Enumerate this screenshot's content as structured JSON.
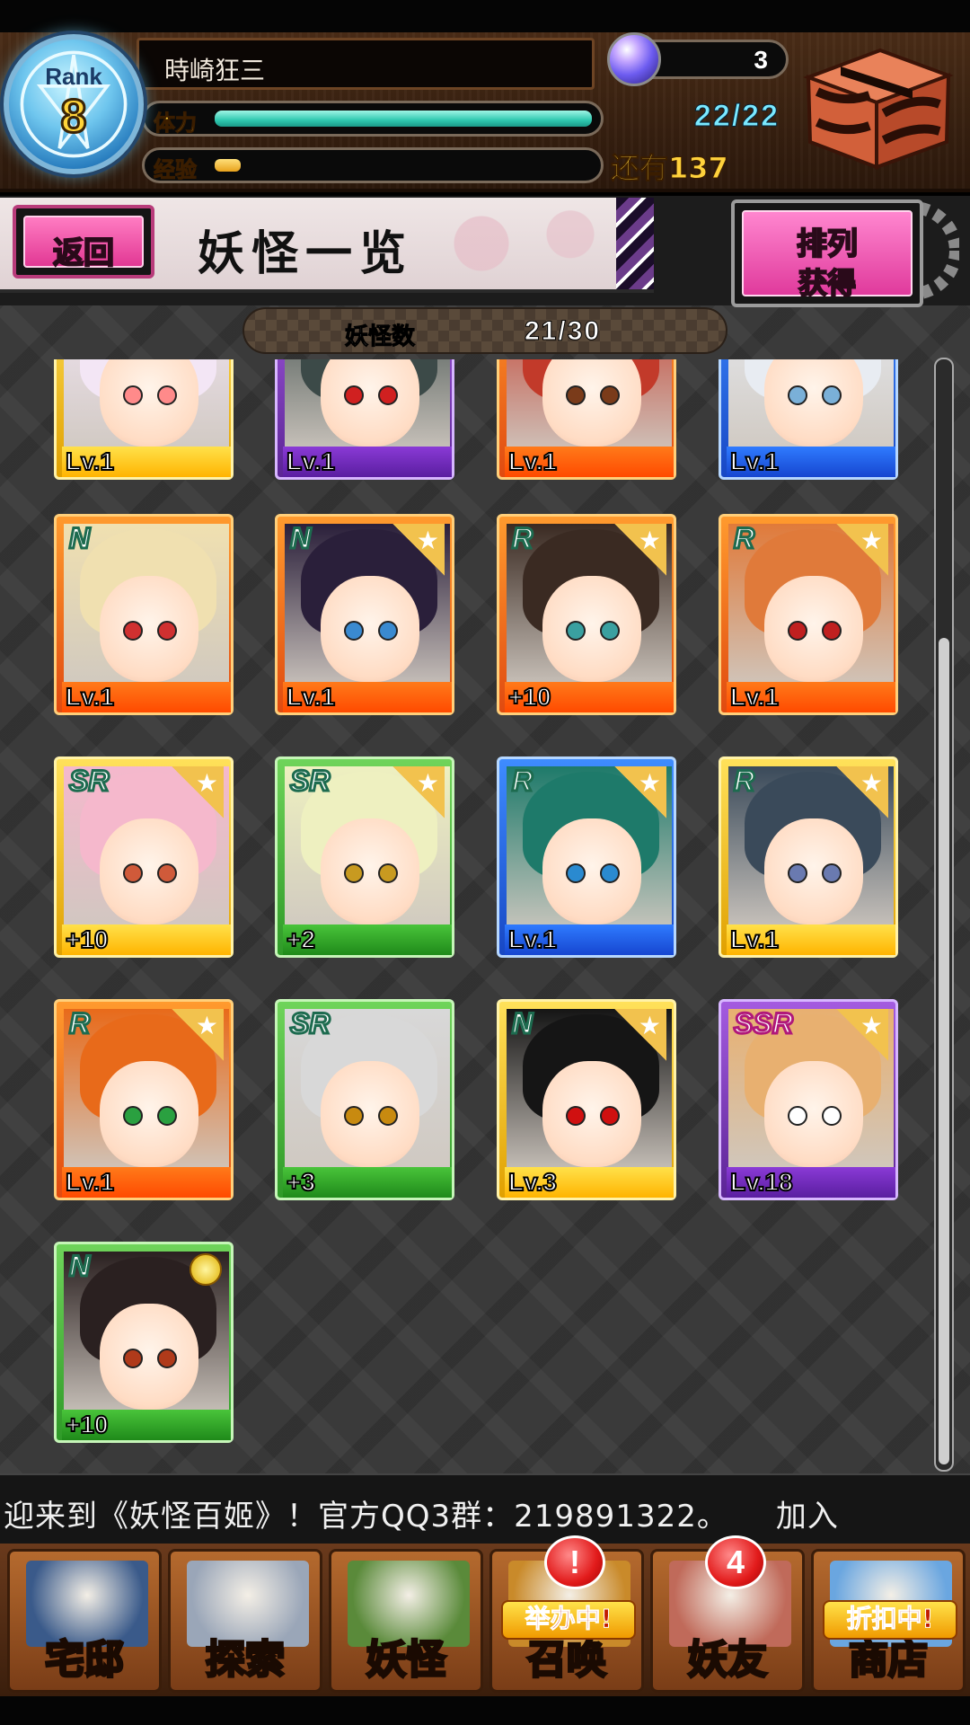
{
  "header": {
    "rank_label": "Rank",
    "rank_value": "8",
    "player_name": "時崎狂三",
    "stamina_label": "体力",
    "stamina_text": "22/22",
    "stamina_fraction": 1.0,
    "exp_label": "经验",
    "exp_fraction": 0.07,
    "exp_remaining": "还有137",
    "orb_count": "3"
  },
  "title_bar": {
    "back_label": "返回",
    "title": "妖怪一览",
    "sort_title": "排列",
    "sort_sub": "获得"
  },
  "collection": {
    "count_label": "妖怪数",
    "count_value": "21/30"
  },
  "cards": [
    {
      "rarity": "",
      "level": "Lv.1",
      "frame": "yellow",
      "hair": "#f3e6f5",
      "eyes": "#ff8a8a",
      "star": false
    },
    {
      "rarity": "",
      "level": "Lv.1",
      "frame": "purple",
      "hair": "#3c4a48",
      "eyes": "#d02020",
      "star": false
    },
    {
      "rarity": "",
      "level": "Lv.1",
      "frame": "orange",
      "hair": "#c23a2a",
      "eyes": "#7a3b1a",
      "star": false
    },
    {
      "rarity": "",
      "level": "Lv.1",
      "frame": "blue",
      "hair": "#e8ecf2",
      "eyes": "#7ab0d8",
      "star": false
    },
    {
      "rarity": "N",
      "level": "Lv.1",
      "frame": "orange",
      "hair": "#f0e0b0",
      "eyes": "#d03030",
      "star": false
    },
    {
      "rarity": "N",
      "level": "Lv.1",
      "frame": "orange",
      "hair": "#2a1f3a",
      "eyes": "#3a8ad0",
      "star": true
    },
    {
      "rarity": "R",
      "level": "+10",
      "frame": "orange",
      "hair": "#3a2a22",
      "eyes": "#3aa0a0",
      "star": true
    },
    {
      "rarity": "R",
      "level": "Lv.1",
      "frame": "orange",
      "hair": "#e07a3a",
      "eyes": "#c02020",
      "star": true
    },
    {
      "rarity": "SR",
      "level": "+10",
      "frame": "yellow",
      "hair": "#f5b8cc",
      "eyes": "#d05a3a",
      "star": true
    },
    {
      "rarity": "SR",
      "level": "+2",
      "frame": "green",
      "hair": "#eef0c0",
      "eyes": "#c89a20",
      "star": true
    },
    {
      "rarity": "R",
      "level": "Lv.1",
      "frame": "blue",
      "hair": "#1e7a6a",
      "eyes": "#2a8ad0",
      "star": true
    },
    {
      "rarity": "R",
      "level": "Lv.1",
      "frame": "yellow",
      "hair": "#3a4a5a",
      "eyes": "#6a7ab0",
      "star": true
    },
    {
      "rarity": "R",
      "level": "Lv.1",
      "frame": "orange",
      "hair": "#e86a1a",
      "eyes": "#2aa040",
      "star": true
    },
    {
      "rarity": "SR",
      "level": "+3",
      "frame": "green",
      "hair": "#d8d8d8",
      "eyes": "#c88a10",
      "star": false
    },
    {
      "rarity": "N",
      "level": "Lv.3",
      "frame": "yellow",
      "hair": "#151515",
      "eyes": "#d01010",
      "star": true
    },
    {
      "rarity": "SSR",
      "level": "Lv.18",
      "frame": "purple",
      "hair": "#e8b070",
      "eyes": "#ffffff",
      "star": true,
      "selected": true
    },
    {
      "rarity": "N",
      "level": "+10",
      "frame": "green",
      "hair": "#2a2020",
      "eyes": "#b03a1a",
      "star": false,
      "medal": true,
      "selected": true
    }
  ],
  "marquee": {
    "text": "迎来到《妖怪百姬》！官方QQ3群：219891322。　　加入"
  },
  "nav": [
    {
      "label": "宅邸",
      "banner": "",
      "badge": "",
      "color": "#3a5a8a"
    },
    {
      "label": "探索",
      "banner": "",
      "badge": "",
      "color": "#9aa6b8"
    },
    {
      "label": "妖怪",
      "banner": "",
      "badge": "",
      "color": "#5a8a3a"
    },
    {
      "label": "召唤",
      "banner": "举办中!",
      "badge": "!",
      "color": "#c98a2a"
    },
    {
      "label": "妖友",
      "banner": "",
      "badge": "4",
      "color": "#c06a5a"
    },
    {
      "label": "商店",
      "banner": "折扣中!",
      "badge": "",
      "color": "#6aa6e0"
    }
  ],
  "colors": {
    "accent_pink": "#e23894",
    "stamina": "#2fc8b0",
    "exp": "#e8a21c",
    "rarity_text_stroke": "#1d6b4f"
  }
}
